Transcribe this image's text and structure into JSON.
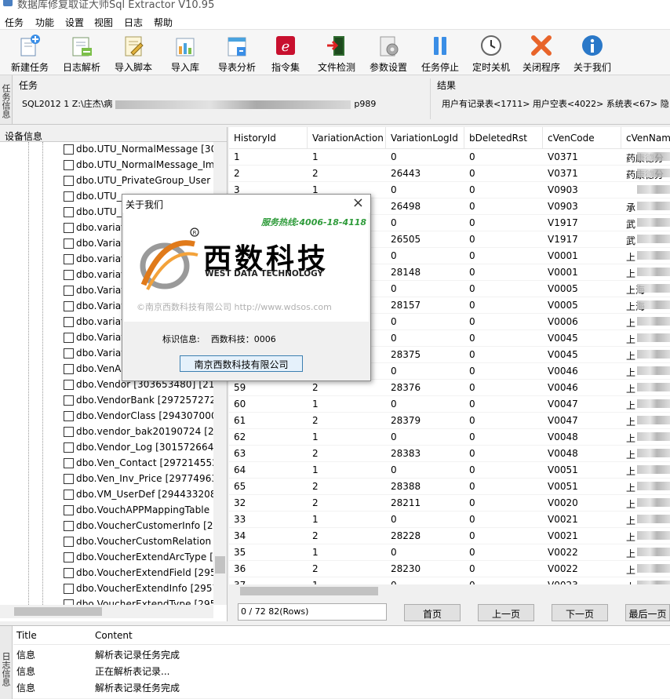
{
  "app": {
    "title": "数据库修复取证大师Sql Extractor V10.95"
  },
  "menu": [
    "任务",
    "功能",
    "设置",
    "视图",
    "日志",
    "帮助"
  ],
  "toolbar": [
    {
      "label": "新建任务",
      "icon": "new-task-icon"
    },
    {
      "label": "日志解析",
      "icon": "log-parse-icon"
    },
    {
      "label": "导入脚本",
      "icon": "import-script-icon"
    },
    {
      "label": "导入库",
      "icon": "import-db-icon"
    },
    {
      "label": "导表分析",
      "icon": "table-analysis-icon"
    },
    {
      "label": "指令集",
      "icon": "command-set-icon"
    },
    {
      "label": "文件检测",
      "icon": "file-check-icon"
    },
    {
      "label": "参数设置",
      "icon": "settings-icon"
    },
    {
      "label": "任务停止",
      "icon": "pause-icon"
    },
    {
      "label": "定时关机",
      "icon": "clock-icon"
    },
    {
      "label": "关闭程序",
      "icon": "close-program-icon"
    },
    {
      "label": "关于我们",
      "icon": "info-icon"
    }
  ],
  "task_panel": {
    "side_tab": "任务信息",
    "task_label": "任务",
    "task_value_prefix": "SQL2012 1 Z:\\庄杰\\病",
    "task_value_suffix": "p989",
    "result_label": "结果",
    "result_value": "用户有记录表<1711> 用户空表<4022> 系统表<67> 隐"
  },
  "device_panel": {
    "header": "设备信息",
    "items": [
      "dbo.UTU_NormalMessage [30",
      "dbo.UTU_NormalMessage_Im",
      "dbo.UTU_PrivateGroup_User [",
      "dbo.UTU_",
      "dbo.UTU_",
      "dbo.variat",
      "dbo.Variat",
      "dbo.variat",
      "dbo.variat",
      "dbo.Variat",
      "dbo.Variat",
      "dbo.variat",
      "dbo.Variat",
      "dbo.Variat",
      "dbo.VenAr",
      "dbo.Vendor [303653480] [214",
      "dbo.VendorBank [297257272]",
      "dbo.VendorClass [294307000]",
      "dbo.vendor_bak20190724 [29",
      "dbo.Vendor_Log [301572664]",
      "dbo.Ven_Contact [297214552]",
      "dbo.Ven_Inv_Price [29774963",
      "dbo.VM_UserDef [294433208]",
      "dbo.VouchAPPMappingTable",
      "dbo.VoucherCustomerInfo [29",
      "dbo.VoucherCustomRelation [",
      "dbo.VoucherExtendArcType [2",
      "dbo.VoucherExtendField [2957",
      "dbo.VoucherExtendInfo [2957",
      "dbo.VoucherExtendType [2957"
    ]
  },
  "grid": {
    "columns": [
      "HistoryId",
      "VariationAction",
      "VariationLogId",
      "bDeletedRst",
      "cVenCode",
      "cVenNam"
    ],
    "rows": [
      [
        "1",
        "1",
        "0",
        "0",
        "V0371",
        "药康德分"
      ],
      [
        "2",
        "2",
        "26443",
        "0",
        "V0371",
        "药康德分"
      ],
      [
        "3",
        "1",
        "0",
        "0",
        "V0903",
        ""
      ],
      [
        "4",
        "2",
        "26498",
        "0",
        "V0903",
        "承"
      ],
      [
        "5",
        "1",
        "0",
        "0",
        "V1917",
        "武"
      ],
      [
        "6",
        "2",
        "26505",
        "0",
        "V1917",
        "武"
      ],
      [
        "7",
        "1",
        "0",
        "0",
        "V0001",
        "上"
      ],
      [
        "8",
        "2",
        "28148",
        "0",
        "V0001",
        "上"
      ],
      [
        "9",
        "1",
        "0",
        "0",
        "V0005",
        "上海"
      ],
      [
        "10",
        "2",
        "28157",
        "0",
        "V0005",
        "上海"
      ],
      [
        "11",
        "1",
        "0",
        "0",
        "V0006",
        "上"
      ],
      [
        "12",
        "1",
        "0",
        "0",
        "V0045",
        "上"
      ],
      [
        "13",
        "2",
        "28375",
        "0",
        "V0045",
        "上"
      ],
      [
        "14",
        "1",
        "0",
        "0",
        "V0046",
        "上"
      ],
      [
        "59",
        "2",
        "28376",
        "0",
        "V0046",
        "上"
      ],
      [
        "60",
        "1",
        "0",
        "0",
        "V0047",
        "上"
      ],
      [
        "61",
        "2",
        "28379",
        "0",
        "V0047",
        "上"
      ],
      [
        "62",
        "1",
        "0",
        "0",
        "V0048",
        "上"
      ],
      [
        "63",
        "2",
        "28383",
        "0",
        "V0048",
        "上"
      ],
      [
        "64",
        "1",
        "0",
        "0",
        "V0051",
        "上"
      ],
      [
        "65",
        "2",
        "28388",
        "0",
        "V0051",
        "上"
      ],
      [
        "32",
        "2",
        "28211",
        "0",
        "V0020",
        "上"
      ],
      [
        "33",
        "1",
        "0",
        "0",
        "V0021",
        "上"
      ],
      [
        "34",
        "2",
        "28228",
        "0",
        "V0021",
        "上"
      ],
      [
        "35",
        "1",
        "0",
        "0",
        "V0022",
        "上"
      ],
      [
        "36",
        "2",
        "28230",
        "0",
        "V0022",
        "上"
      ],
      [
        "37",
        "1",
        "0",
        "0",
        "V0023",
        "上"
      ]
    ]
  },
  "pager": {
    "info": "0 / 72 82(Rows)",
    "first": "首页",
    "prev": "上一页",
    "next": "下一页",
    "last": "最后一页"
  },
  "log": {
    "side_tab": "日志信息",
    "col_title": "Title",
    "col_content": "Content",
    "rows": [
      {
        "title": "信息",
        "content": "解析表记录任务完成"
      },
      {
        "title": "信息",
        "content": "正在解析表记录..."
      },
      {
        "title": "信息",
        "content": "解析表记录任务完成"
      }
    ]
  },
  "dialog": {
    "title": "关于我们",
    "hotline": "服务热线:4006-18-4118",
    "company_cn": "西数科技",
    "company_en": "WEST DATA TECHNOLOGY",
    "copyright": "©南京西数科技有限公司  http://www.wdsos.com",
    "id_label": "标识信息:",
    "id_value": "西数科技：0006",
    "button": "南京西数科技有限公司"
  },
  "colors": {
    "accent": "#e07a1a",
    "hotline": "#2e9b3a",
    "button_border": "#3c7fb1"
  }
}
